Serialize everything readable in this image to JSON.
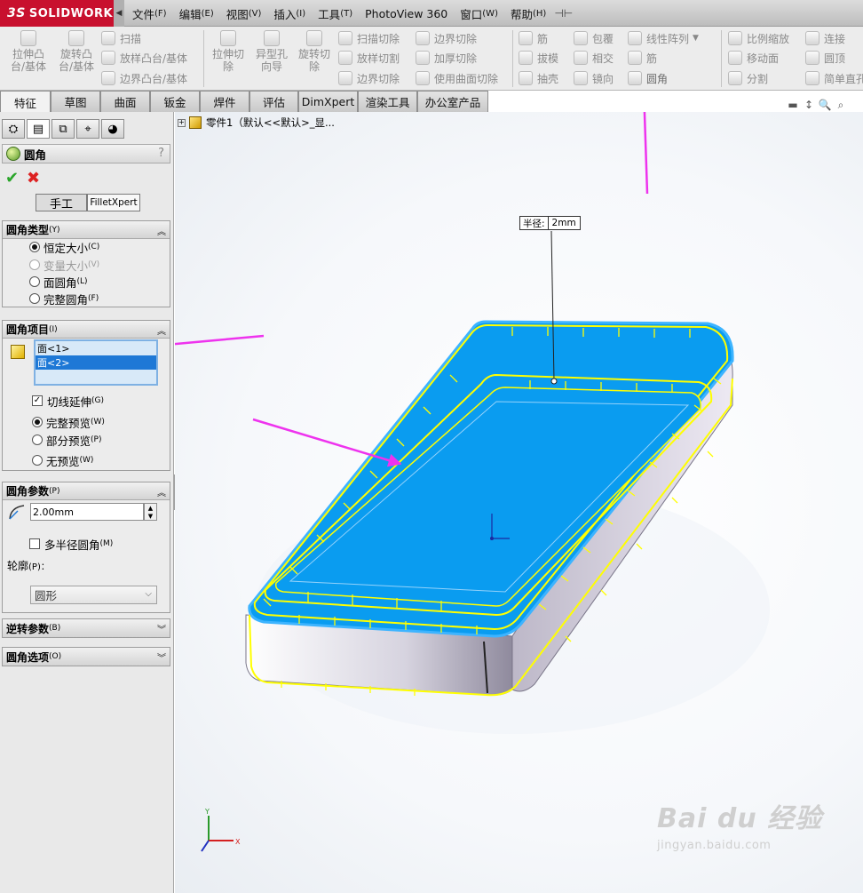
{
  "app": {
    "logo_mark": "3S",
    "logo_text": "SOLIDWORKS",
    "menu": [
      {
        "label": "文件",
        "acc": "(F)"
      },
      {
        "label": "编辑",
        "acc": "(E)"
      },
      {
        "label": "视图",
        "acc": "(V)"
      },
      {
        "label": "插入",
        "acc": "(I)"
      },
      {
        "label": "工具",
        "acc": "(T)"
      },
      {
        "label": "PhotoView 360",
        "acc": ""
      },
      {
        "label": "窗口",
        "acc": "(W)"
      },
      {
        "label": "帮助",
        "acc": "(H)"
      }
    ]
  },
  "ribbon": {
    "big": [
      "拉伸凸\n台/基体",
      "旋转凸\n台/基体",
      "拉伸切\n除",
      "异型孔\n向导",
      "旋转切\n除"
    ],
    "col_a": [
      "扫描",
      "放样凸台/基体",
      "边界凸台/基体"
    ],
    "col_b": [
      "扫描切除",
      "放样切割",
      "边界切除"
    ],
    "col_c": [
      "边界切除",
      "加厚切除",
      "使用曲面切除"
    ],
    "col_d": [
      "筋",
      "拔模",
      "抽壳"
    ],
    "col_e": [
      "包覆",
      "相交",
      "镜向"
    ],
    "col_f": [
      "线性阵列",
      "筋",
      "圆角"
    ],
    "col_g": [
      "比例缩放",
      "移动面",
      "分割"
    ],
    "col_h": [
      "连接",
      "圆顶",
      "简单直孔"
    ]
  },
  "tabs": [
    "特征",
    "草图",
    "曲面",
    "钣金",
    "焊件",
    "评估",
    "DimXpert",
    "渲染工具",
    "办公室产品"
  ],
  "property_manager": {
    "title": "圆角",
    "help": "?",
    "mode_manual": "手工",
    "mode_xpert": "FilletXpert",
    "fillet_type": {
      "title": "圆角类型",
      "acc": "(Y)",
      "options": [
        {
          "label": "恒定大小",
          "acc": "(C)"
        },
        {
          "label": "变量大小",
          "acc": "(V)"
        },
        {
          "label": "面圆角",
          "acc": "(L)"
        },
        {
          "label": "完整圆角",
          "acc": "(F)"
        }
      ],
      "selected": "恒定大小"
    },
    "fillet_items": {
      "title": "圆角项目",
      "acc": "(I)",
      "faces": [
        "面<1>",
        "面<2>"
      ],
      "tangent": {
        "label": "切线延伸",
        "acc": "(G)",
        "checked": true
      },
      "preview": [
        {
          "label": "完整预览",
          "acc": "(W)"
        },
        {
          "label": "部分预览",
          "acc": "(P)"
        },
        {
          "label": "无预览",
          "acc": "(W)"
        }
      ],
      "preview_selected": "完整预览"
    },
    "fillet_params": {
      "title": "圆角参数",
      "acc": "(P)",
      "radius": "2.00mm",
      "multi_radius": {
        "label": "多半径圆角",
        "acc": "(M)",
        "checked": false
      },
      "profile_label": "轮廓",
      "profile_acc": "(P)：",
      "profile_value": "圆形"
    },
    "reverse_params": {
      "title": "逆转参数",
      "acc": "(B)"
    },
    "fillet_options": {
      "title": "圆角选项",
      "acc": "(O)"
    }
  },
  "viewport": {
    "tree_root": "零件1（默认<<默认>_显...",
    "callout_label": "半径:",
    "callout_value": "2mm"
  },
  "watermark": {
    "brand": "Bai du 经验",
    "url": "jingyan.baidu.com"
  },
  "colors": {
    "face_blue": "#0a9cf0",
    "edge_yellow": "#ffff00",
    "arrow_magenta": "#ee33ee",
    "logo_red": "#c8102e"
  }
}
